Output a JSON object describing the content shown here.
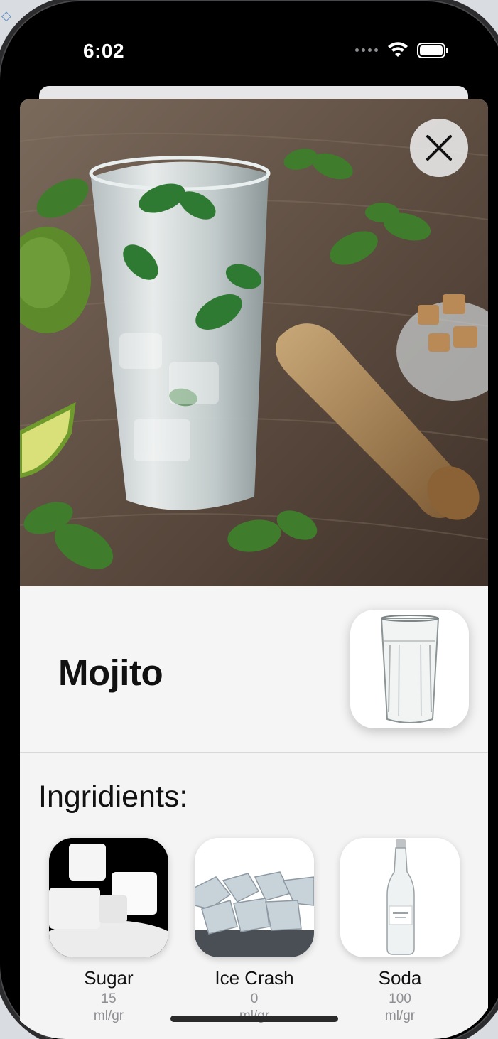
{
  "status_bar": {
    "time": "6:02"
  },
  "icons": {
    "close": "close-icon",
    "wifi": "wifi-icon",
    "battery": "battery-icon",
    "signal": "signal-dots-icon"
  },
  "drink": {
    "name": "Mojito"
  },
  "ingredients": {
    "title": "Ingridients:",
    "items": [
      {
        "name": "Sugar",
        "amount": "15",
        "unit": "ml/gr"
      },
      {
        "name": "Ice Crash",
        "amount": "0",
        "unit": "ml/gr"
      },
      {
        "name": "Soda",
        "amount": "100",
        "unit": "ml/gr"
      }
    ]
  },
  "colors": {
    "card_background": "#f4f4f4",
    "text_primary": "#111111",
    "text_secondary": "#8e8e93"
  }
}
